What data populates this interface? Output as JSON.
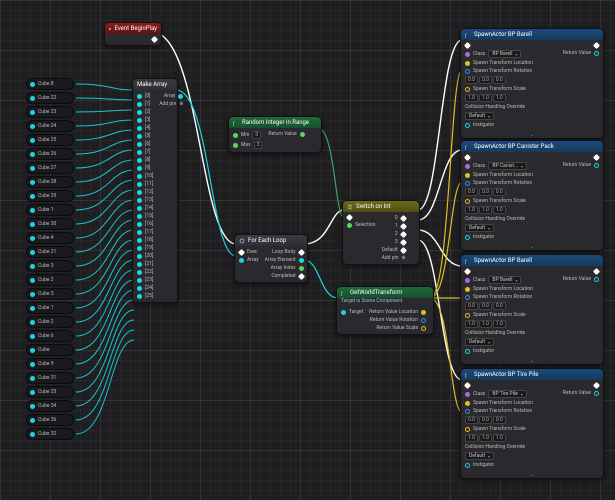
{
  "event": {
    "title": "Event BeginPlay"
  },
  "makeArray": {
    "title": "Make Array",
    "outLabel": "Array",
    "addPin": "Add pin",
    "inputs": [
      "[0]",
      "[1]",
      "[2]",
      "[3]",
      "[4]",
      "[5]",
      "[6]",
      "[7]",
      "[8]",
      "[9]",
      "[10]",
      "[11]",
      "[12]",
      "[13]",
      "[14]",
      "[15]",
      "[16]",
      "[17]",
      "[18]",
      "[19]",
      "[20]",
      "[21]",
      "[22]",
      "[23]",
      "[24]",
      "[25]"
    ]
  },
  "cubes": [
    "Cube 8",
    "Cube 22",
    "Cube 23",
    "Cube 24",
    "Cube 25",
    "Cube 26",
    "Cube 27",
    "Cube 28",
    "Cube 29",
    "Cube 1",
    "Cube 30",
    "Cube 4",
    "Cube 21",
    "Cube 3",
    "Cube 2",
    "Cube 5",
    "Cube 1",
    "Cube 2",
    "Cube 6",
    "Cube",
    "Cube 9",
    "Cube 31",
    "Cube 33",
    "Cube 34",
    "Cube 36",
    "Cube 32"
  ],
  "randInt": {
    "title": "Random Integer in Range",
    "min": "Min",
    "minVal": "0",
    "max": "Max",
    "maxVal": "3",
    "out": "Return Value"
  },
  "forEach": {
    "title": "For Each Loop",
    "exec": "Exec",
    "array": "Array",
    "loopBody": "Loop Body",
    "elem": "Array Element",
    "index": "Array Index",
    "completed": "Completed"
  },
  "switch": {
    "title": "Switch on Int",
    "selection": "Selection",
    "default": "Default",
    "addPin": "Add pin",
    "cases": [
      "0",
      "1",
      "2",
      "3"
    ]
  },
  "getTransform": {
    "title": "GetWorldTransform",
    "sub": "Target is Scene Component",
    "target": "Target",
    "loc": "Return Value Location",
    "rot": "Return Value Rotation",
    "scale": "Return Value Scale"
  },
  "spawn": {
    "common": {
      "title": "SpawnActor",
      "class": "Class",
      "ret": "Return Value",
      "loc": "Spawn Transform Location",
      "rot": "Spawn Transform Rotation",
      "scale": "Spawn Transform Scale",
      "collision": "Collision Handling Override",
      "collisionVal": "Default",
      "instigator": "Instigator",
      "zero": "0.0",
      "one": "1.0"
    },
    "items": [
      {
        "cls": "BP Barell",
        "classDrop": "BP Barell"
      },
      {
        "cls": "BP Canister Pack",
        "classDrop": "BP Canist..."
      },
      {
        "cls": "BP Barell",
        "classDrop": "BP Barell"
      },
      {
        "cls": "BP Tire Pile",
        "classDrop": "BP Tire Pile"
      }
    ]
  }
}
